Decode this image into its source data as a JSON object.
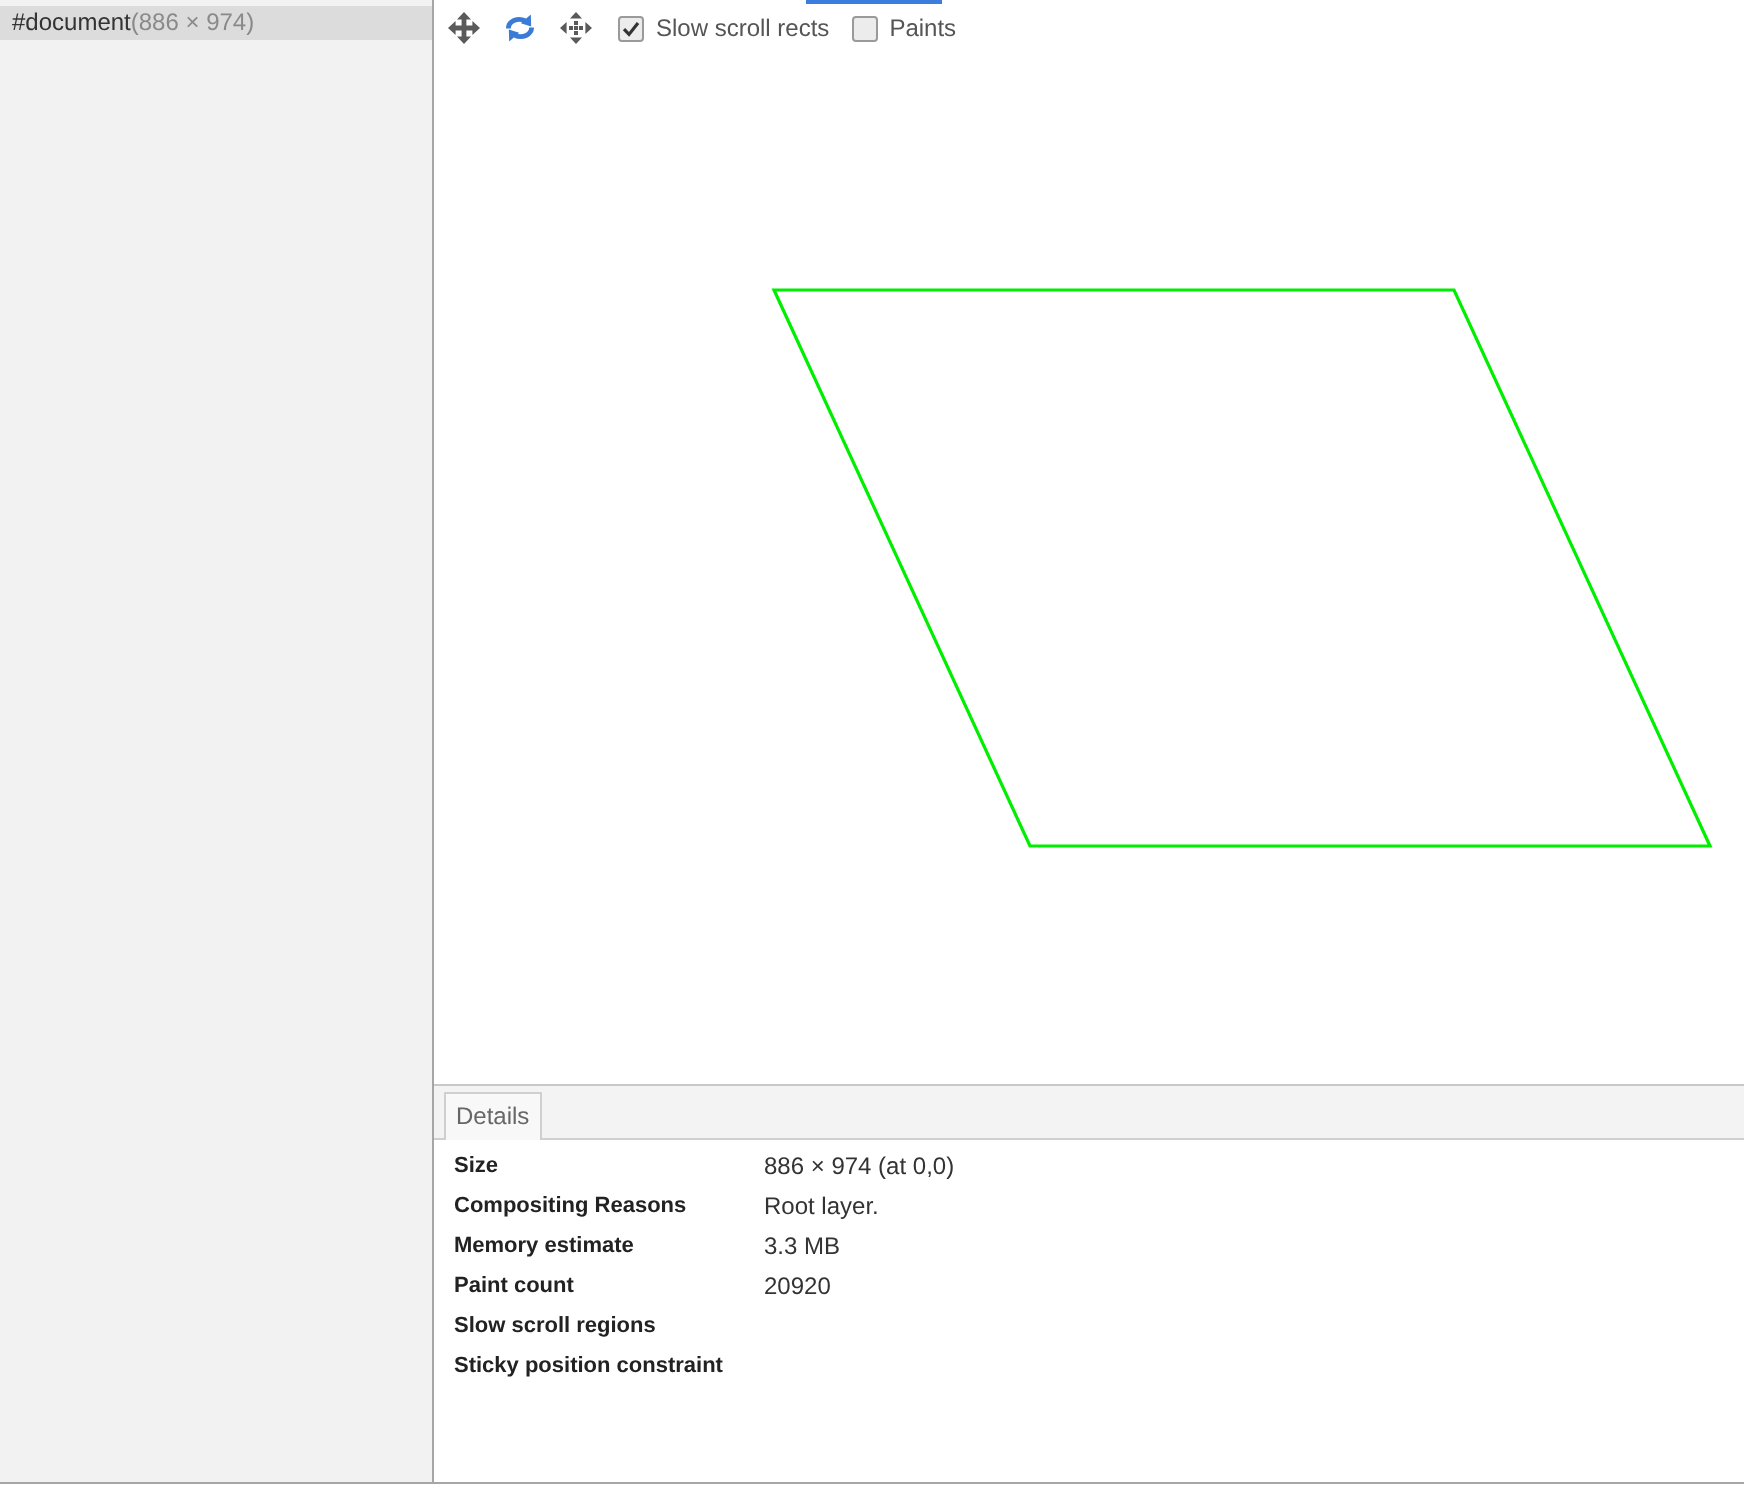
{
  "layer_tree": {
    "items": [
      {
        "name": "#document",
        "size": "(886 × 974)",
        "selected": true
      }
    ]
  },
  "toolbar": {
    "modes": [
      {
        "kind": "pan",
        "selected": false
      },
      {
        "kind": "rotate",
        "selected": true
      },
      {
        "kind": "reset",
        "selected": false
      }
    ],
    "checkboxes": [
      {
        "label": "Slow scroll rects",
        "checked": true
      },
      {
        "label": "Paints",
        "checked": false
      }
    ]
  },
  "details": {
    "tabs": [
      {
        "label": "Details",
        "selected": true
      }
    ],
    "rows": [
      {
        "label": "Size",
        "value": "886 × 974 (at 0,0)"
      },
      {
        "label": "Compositing Reasons",
        "value": "Root layer."
      },
      {
        "label": "Memory estimate",
        "value": "3.3 MB"
      },
      {
        "label": "Paint count",
        "value": "20920"
      },
      {
        "label": "Slow scroll regions"
      },
      {
        "label": "Sticky position constraint"
      }
    ]
  }
}
